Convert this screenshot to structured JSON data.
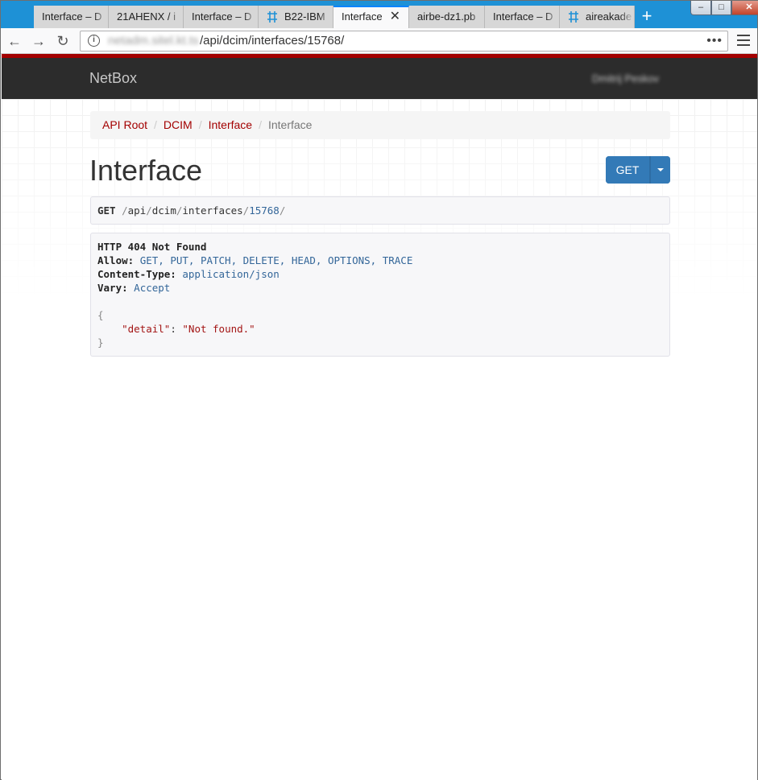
{
  "browser": {
    "tabs": [
      {
        "label": "Interface – D",
        "icon": "none"
      },
      {
        "label": "21AHENX / i",
        "icon": "none"
      },
      {
        "label": "Interface – D",
        "icon": "none"
      },
      {
        "label": "B22-IBM",
        "icon": "network-icon"
      },
      {
        "label": "Interface",
        "icon": "none",
        "active": true
      },
      {
        "label": "airbe-dz1.pb",
        "icon": "none"
      },
      {
        "label": "Interface – D",
        "icon": "none"
      },
      {
        "label": "aireakade",
        "icon": "network-icon"
      }
    ],
    "new_tab": "+",
    "url_host": "netadm.sitel.kt.ts",
    "url_path": "/api/dcim/interfaces/15768/",
    "overflow": "•••"
  },
  "app": {
    "brand": "NetBox",
    "user": "Dmitrij Peskov"
  },
  "breadcrumb": {
    "items": [
      "API Root",
      "DCIM",
      "Interface"
    ],
    "current": "Interface"
  },
  "page": {
    "title": "Interface",
    "get_button": "GET"
  },
  "request": {
    "method": "GET",
    "path_segments": [
      "api",
      "dcim",
      "interfaces",
      "15768"
    ]
  },
  "response": {
    "status_line": "HTTP 404 Not Found",
    "headers": [
      {
        "name": "Allow:",
        "value": "GET, PUT, PATCH, DELETE, HEAD, OPTIONS, TRACE"
      },
      {
        "name": "Content-Type:",
        "value": "application/json"
      },
      {
        "name": "Vary:",
        "value": "Accept"
      }
    ],
    "body_open": "{",
    "body_key": "\"detail\"",
    "body_colon": ": ",
    "body_value": "\"Not found.\"",
    "body_close": "}"
  },
  "colors": {
    "accent_red": "#a30000",
    "button_blue": "#337ab7",
    "navbar_dark": "#2c2c2c",
    "tabstrip_blue": "#1e91d6"
  }
}
